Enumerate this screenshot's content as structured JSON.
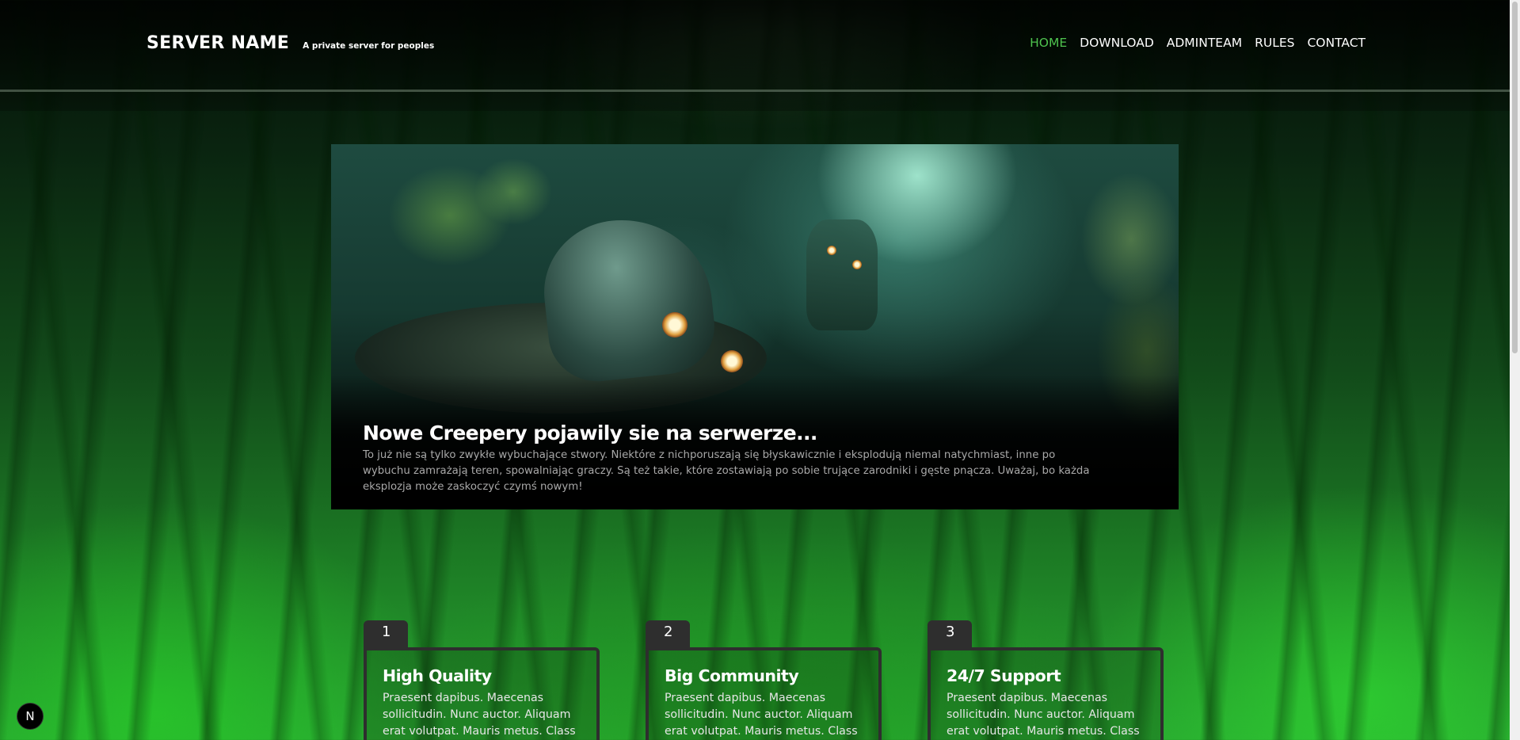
{
  "brand": {
    "title": "SERVER NAME",
    "tagline": "A private server for peoples"
  },
  "nav": {
    "items": [
      {
        "label": "HOME",
        "active": true
      },
      {
        "label": "DOWNLOAD",
        "active": false
      },
      {
        "label": "ADMINTEAM",
        "active": false
      },
      {
        "label": "RULES",
        "active": false
      },
      {
        "label": "CONTACT",
        "active": false
      }
    ],
    "active_color": "#4ec24e"
  },
  "hero": {
    "title": "Nowe Creepery pojawily sie na serwerze...",
    "text": "To już nie są tylko zwykłe wybuchające stwory. Niektóre z nichporuszają się błyskawicznie i eksplodują niemal natychmiast, inne po wybuchu zamrażają teren, spowalniając graczy. Są też takie, które zostawiają po sobie trujące zarodniki i gęste pnącza. Uważaj, bo każda eksplozja może zaskoczyć czymś nowym!"
  },
  "features": [
    {
      "number": "1",
      "title": "High Quality",
      "text": "Praesent dapibus. Maecenas sollicitudin. Nunc auctor. Aliquam erat volutpat. Mauris metus. Class"
    },
    {
      "number": "2",
      "title": "Big Community",
      "text": "Praesent dapibus. Maecenas sollicitudin. Nunc auctor. Aliquam erat volutpat. Mauris metus. Class"
    },
    {
      "number": "3",
      "title": "24/7 Support",
      "text": "Praesent dapibus. Maecenas sollicitudin. Nunc auctor. Aliquam erat volutpat. Mauris metus. Class"
    }
  ],
  "dev_badge": {
    "letter": "N"
  },
  "colors": {
    "accent": "#4ec24e",
    "feature_border": "#2e2e2e"
  }
}
